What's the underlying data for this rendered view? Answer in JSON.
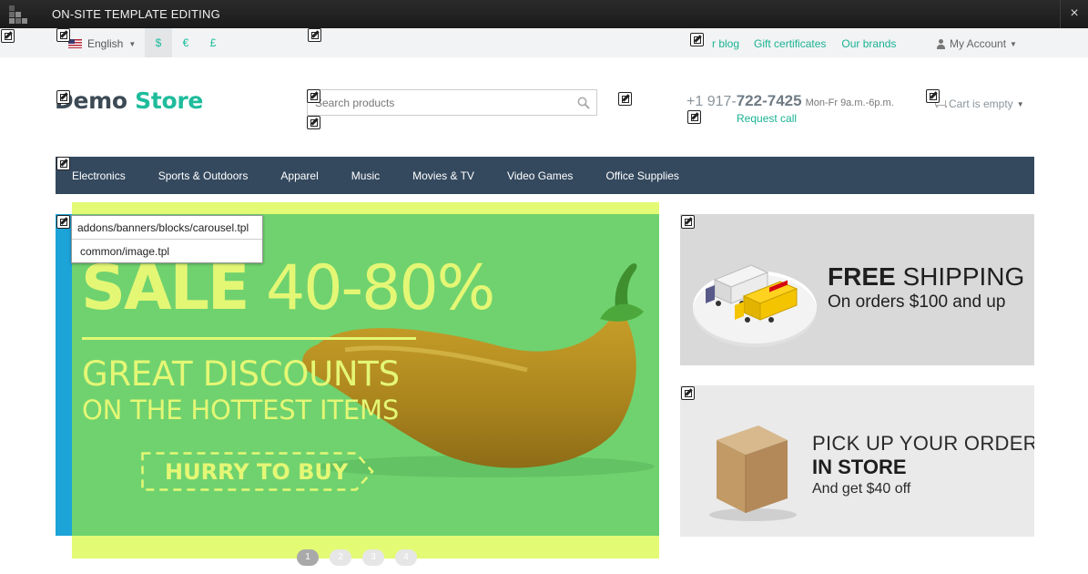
{
  "edit_bar": {
    "title": "ON-SITE TEMPLATE EDITING",
    "close": "×"
  },
  "top_bar": {
    "language": "English",
    "currencies": [
      {
        "symbol": "$",
        "active": true
      },
      {
        "symbol": "€",
        "active": false
      },
      {
        "symbol": "£",
        "active": false
      }
    ],
    "links": [
      "r blog",
      "Gift certificates",
      "Our brands"
    ],
    "account": "My Account"
  },
  "header": {
    "logo_part1": "Demo",
    "logo_part2": "Store",
    "search_placeholder": "Search products",
    "phone_prefix": "+1 917-",
    "phone_main": "722-7425",
    "hours": "Mon-Fr 9a.m.-6p.m.",
    "request_call": "Request call",
    "cart": "Cart is empty"
  },
  "nav": [
    "Electronics",
    "Sports & Outdoors",
    "Apparel",
    "Music",
    "Movies & TV",
    "Video Games",
    "Office Supplies"
  ],
  "carousel": {
    "sale_bold": "SALE",
    "sale_range": "40-80%",
    "line1": "GREAT DISCOUNTS",
    "line2": "ON THE HOTTEST ITEMS",
    "cta": "HURRY TO BUY",
    "template_paths": [
      "addons/banners/blocks/carousel.tpl",
      "common/image.tpl"
    ],
    "pages": [
      "1",
      "2",
      "3",
      "4"
    ],
    "active_page": 0
  },
  "banners": {
    "shipping_bold": "FREE",
    "shipping_rest": " SHIPPING",
    "shipping_sub": "On orders $100 and up",
    "pickup_line1": "PICK UP YOUR ORDER",
    "pickup_line2": "IN STORE",
    "pickup_sub": "And get $40 off"
  },
  "icons": {
    "edit": "pencil-edit-icon",
    "search": "magnifier-icon",
    "account": "user-icon",
    "cart": "cart-icon",
    "flag": "us-flag-icon"
  },
  "colors": {
    "accent": "#1abc9c",
    "nav_bg": "#34495e",
    "carousel_bg": "#6fd26f",
    "carousel_text": "#e4f775",
    "template_highlight": "#e3fa74"
  }
}
